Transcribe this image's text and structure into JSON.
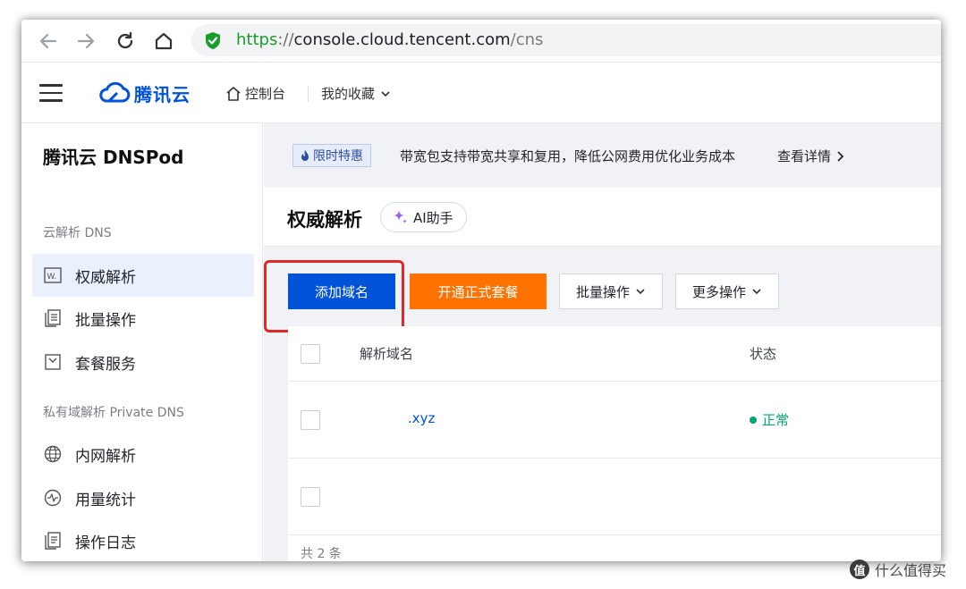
{
  "browser": {
    "url_scheme": "https",
    "url_sep": "://",
    "url_host": "console.cloud.tencent.com",
    "url_path": "/cns"
  },
  "header": {
    "brand": "腾讯云",
    "console": "控制台",
    "favorites": "我的收藏"
  },
  "sidebar": {
    "title": "腾讯云 DNSPod",
    "group1": "云解析 DNS",
    "group2": "私有域解析 Private DNS",
    "items": [
      {
        "label": "权威解析"
      },
      {
        "label": "批量操作"
      },
      {
        "label": "套餐服务"
      },
      {
        "label": "内网解析"
      },
      {
        "label": "用量统计"
      },
      {
        "label": "操作日志"
      }
    ]
  },
  "promo": {
    "tag": "限时特惠",
    "text": "带宽包支持带宽共享和复用，降低公网费用优化业务成本",
    "link": "查看详情"
  },
  "page": {
    "title": "权威解析",
    "ai_button": "AI助手"
  },
  "toolbar": {
    "add_domain": "添加域名",
    "open_package": "开通正式套餐",
    "batch_ops": "批量操作",
    "more_ops": "更多操作"
  },
  "table": {
    "headers": {
      "domain": "解析域名",
      "status": "状态"
    },
    "rows": [
      {
        "domain": ".xyz",
        "status": "正常"
      },
      {
        "domain": "",
        "status": ""
      }
    ],
    "footer": "共 2 条"
  },
  "watermark": {
    "icon": "值",
    "text": "什么值得买"
  },
  "colors": {
    "brand": "#0052d9",
    "orange": "#ff7200",
    "success": "#00a870",
    "highlight": "#e02a2a"
  }
}
